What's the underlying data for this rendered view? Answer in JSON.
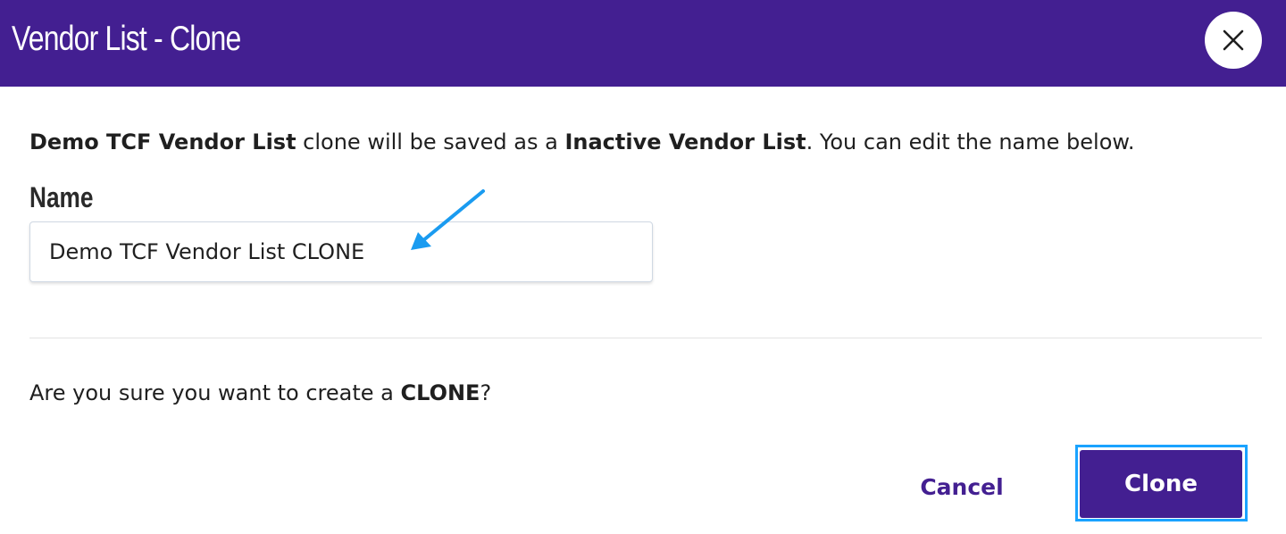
{
  "dialog": {
    "title": "Vendor List - Clone",
    "close_icon": "close-icon"
  },
  "intro": {
    "list_name": "Demo TCF Vendor List",
    "text_1": " clone will be saved as a ",
    "status": "Inactive Vendor List",
    "text_2": ". You can edit the name below."
  },
  "form": {
    "name_label": "Name",
    "name_value": "Demo TCF Vendor List CLONE"
  },
  "annotation": {
    "icon": "arrow-icon",
    "color": "#1a9bf0"
  },
  "confirm": {
    "text_1": "Are you sure you want to create a ",
    "emphasis": "CLONE",
    "text_2": "?"
  },
  "actions": {
    "cancel_label": "Cancel",
    "clone_label": "Clone"
  },
  "colors": {
    "brand": "#431f91",
    "focus_ring": "#1aa3ff"
  }
}
